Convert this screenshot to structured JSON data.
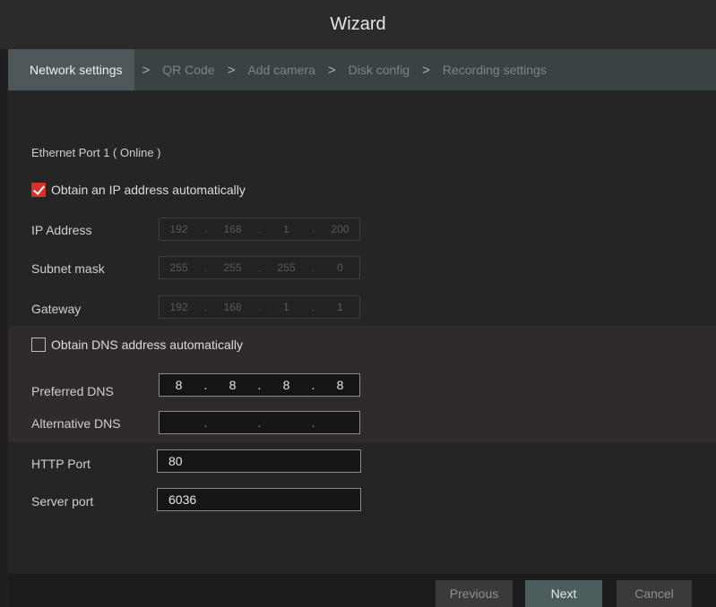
{
  "window": {
    "title": "Wizard"
  },
  "steps": [
    {
      "label": "Network settings"
    },
    {
      "label": "QR Code"
    },
    {
      "label": "Add camera"
    },
    {
      "label": "Disk config"
    },
    {
      "label": "Recording settings"
    }
  ],
  "step_separator": ">",
  "ethernet": {
    "title": "Ethernet Port 1 ( Online )",
    "obtain_ip_auto": {
      "label": "Obtain an IP address automatically",
      "checked": true
    },
    "ip_address": {
      "label": "IP Address",
      "octets": [
        "192",
        "168",
        "1",
        "200"
      ]
    },
    "subnet_mask": {
      "label": "Subnet mask",
      "octets": [
        "255",
        "255",
        "255",
        "0"
      ]
    },
    "gateway": {
      "label": "Gateway",
      "octets": [
        "192",
        "168",
        "1",
        "1"
      ]
    }
  },
  "dns": {
    "obtain_dns_auto": {
      "label": "Obtain DNS address automatically",
      "checked": false
    },
    "preferred": {
      "label": "Preferred DNS",
      "octets": [
        "8",
        "8",
        "8",
        "8"
      ]
    },
    "alternative": {
      "label": "Alternative DNS",
      "octets": [
        "",
        "",
        "",
        ""
      ]
    }
  },
  "ports": {
    "http": {
      "label": "HTTP Port",
      "value": "80"
    },
    "server": {
      "label": "Server port",
      "value": "6036"
    }
  },
  "buttons": {
    "previous": "Previous",
    "next": "Next",
    "cancel": "Cancel"
  },
  "octet_separator": ".",
  "colors": {
    "checkbox_checked": "#d4322a",
    "active_step": "#4e585b"
  }
}
